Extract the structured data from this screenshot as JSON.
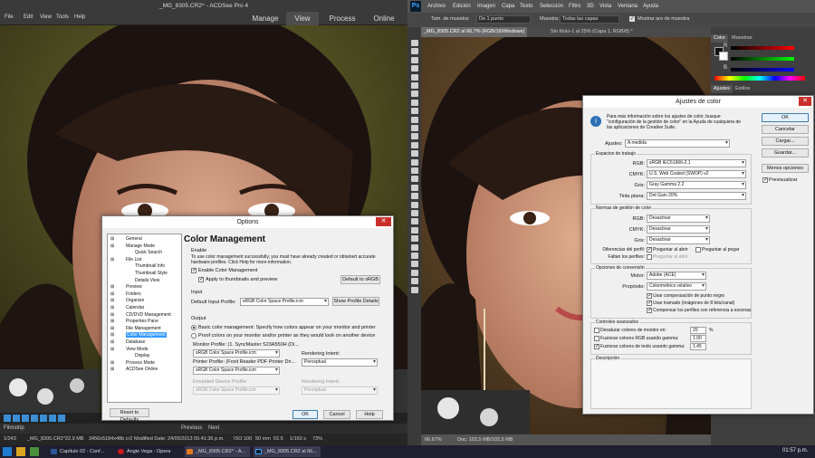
{
  "acdsee": {
    "title": "_MG_8305.CR2^ - ACDSee Pro 4",
    "menus": [
      "File",
      "Edit",
      "View",
      "Tools",
      "Help"
    ],
    "modes": [
      "Manage",
      "View",
      "Process",
      "Online"
    ],
    "active_mode": "View",
    "filmstrip_label": "Filmstrip",
    "prev": "Previous",
    "next": "Next",
    "status": [
      "1/243",
      "_MG_8305.CR2^",
      "22.9 MB",
      "3456x5184x48b cr2",
      "Modified Date: 24/05/2013 05:41:36 p.m.",
      "ISO 100",
      "50 mm",
      "f/2.5",
      "1/160 s",
      "73%"
    ],
    "options": {
      "title": "Options",
      "tree": [
        {
          "label": "General",
          "level": 1
        },
        {
          "label": "Manage Mode",
          "level": 1
        },
        {
          "label": "Quick Search",
          "level": 2
        },
        {
          "label": "File List",
          "level": 1
        },
        {
          "label": "Thumbnail Info",
          "level": 2
        },
        {
          "label": "Thumbnail Style",
          "level": 2
        },
        {
          "label": "Details View",
          "level": 2
        },
        {
          "label": "Preview",
          "level": 1
        },
        {
          "label": "Folders",
          "level": 1
        },
        {
          "label": "Organize",
          "level": 1
        },
        {
          "label": "Calendar",
          "level": 1
        },
        {
          "label": "CD/DVD Management",
          "level": 1
        },
        {
          "label": "Properties Pane",
          "level": 1
        },
        {
          "label": "File Management",
          "level": 1
        },
        {
          "label": "Color Management",
          "level": 1,
          "selected": true
        },
        {
          "label": "Database",
          "level": 1
        },
        {
          "label": "View Mode",
          "level": 1
        },
        {
          "label": "Display",
          "level": 2
        },
        {
          "label": "Process Mode",
          "level": 1
        },
        {
          "label": "ACDSee Online",
          "level": 1
        }
      ],
      "reset": "Reset to Defaults",
      "heading": "Color Management",
      "enable_section": "Enable",
      "enable_desc": "To use color management successfully, you must have already created or obtained accurate hardware profiles. Click Help for more information.",
      "enable_cm": "Enable Color Management",
      "apply_thumbs": "Apply to thumbnails and preview",
      "default_srgb": "Default to sRGB",
      "input_section": "Input",
      "default_input_label": "Default Input Profile:",
      "default_input_value": "sRGB Color Space Profile.icm",
      "show_profile": "Show Profile Details",
      "output_section": "Output",
      "basic_cm": "Basic color management: Specify how colors appear on your monitor and printer",
      "proof_colors": "Proof colors on your monitor and/or printer as they would look on another device",
      "monitor_label": "Monitor Profile: (1. SyncMaster S23A550H (Di...",
      "monitor_value": "sRGB Color Space Profile.icm",
      "printer_label": "Printer Profile: (Foxit Reader PDF Printer Dri...",
      "printer_value": "sRGB Color Space Profile.icm",
      "rendering_label": "Rendering Intent:",
      "rendering_value": "Perceptual",
      "emulated_label": "Emulated Device Profile:",
      "emulated_value": "sRGB Color Space Profile.icm",
      "rendering2_label": "Rendering Intent:",
      "rendering2_value": "Perceptual",
      "ok": "OK",
      "cancel": "Cancel",
      "help": "Help"
    }
  },
  "photoshop": {
    "logo": "Ps",
    "menus": [
      "Archivo",
      "Edición",
      "Imagen",
      "Capa",
      "Texto",
      "Selección",
      "Filtro",
      "3D",
      "Vista",
      "Ventana",
      "Ayuda"
    ],
    "options": {
      "size_label": "Tam. de muestra:",
      "size_value": "De 1 punto",
      "sample_label": "Muestra:",
      "sample_value": "Todas las capas",
      "ring": "Mostrar aro de muestra"
    },
    "tabs": [
      "_MG_8305.CR2 al 66,7% (RGB/16/Windows)",
      "Sin título-1 al 25% (Capa 1, RGB/8) *"
    ],
    "zoom": "66.67%",
    "doc": "Doc: 102,5 MB/102,5 MB",
    "panel_tabs": [
      "Color",
      "Muestras"
    ],
    "panel_tabs2": [
      "Ajustes",
      "Estilos"
    ],
    "slider_labels": [
      "R",
      "G",
      "B"
    ],
    "dialog": {
      "title": "Ajustes de color",
      "info": "Para más información sobre los ajustes de color, busque \"configuración de la gestión de color\" en la Ayuda de cualquiera de las aplicaciones de Creative Suite.",
      "ajustes_label": "Ajustes:",
      "ajustes_value": "A medida",
      "espacios": "Espacios de trabajo",
      "ws": [
        {
          "label": "RGB:",
          "value": "sRGB IEC61966-2.1"
        },
        {
          "label": "CMYK:",
          "value": "U.S. Web Coated (SWOP) v2"
        },
        {
          "label": "Gris:",
          "value": "Gray Gamma 2.2"
        },
        {
          "label": "Tinta plana:",
          "value": "Dot Gain 20%"
        }
      ],
      "normas": "Normas de gestión de color",
      "norms": [
        {
          "label": "RGB:",
          "value": "Desactivar"
        },
        {
          "label": "CMYK:",
          "value": "Desactivar"
        },
        {
          "label": "Gris:",
          "value": "Desactivar"
        }
      ],
      "dif_label": "Diferencias del perfil:",
      "faltan_label": "Faltan los perfiles:",
      "ask_open": "Preguntar al abrir",
      "ask_paste": "Preguntar al pegar",
      "ask_open2": "Preguntar al abrir",
      "conversion": "Opciones de conversión",
      "motor_label": "Motor:",
      "motor_value": "Adobe (ACE)",
      "proposito_label": "Propósito:",
      "proposito_value": "Colorimétrico relativo",
      "conv_checks": [
        "Usar compensación de punto negro",
        "Usar tramado (imágenes de 8 bits/canal)",
        "Compensar los perfiles con referencia a escenas"
      ],
      "avanzados": "Controles avanzados",
      "adv": [
        {
          "label": "Desaturar colores de monitor en:",
          "value": "20",
          "unit": "%"
        },
        {
          "label": "Fusionar colores RGB usando gamma:",
          "value": "1.00",
          "unit": ""
        },
        {
          "label": "Fusionar colores de texto usando gamma:",
          "value": "1.45",
          "unit": ""
        }
      ],
      "descripcion": "Descripción",
      "buttons": [
        "OK",
        "Cancelar",
        "Cargar...",
        "Guardar..."
      ],
      "more": "Menos opciones",
      "preview": "Previsualizar"
    }
  },
  "taskbar": {
    "tasks": [
      "Capítulo 02 - Conf...",
      "Angie Vega - Opera",
      "_MG_8305.CR2^ - A...",
      "_MG_8305.CR2 al 66..."
    ],
    "clock": "01:57 p.m."
  }
}
